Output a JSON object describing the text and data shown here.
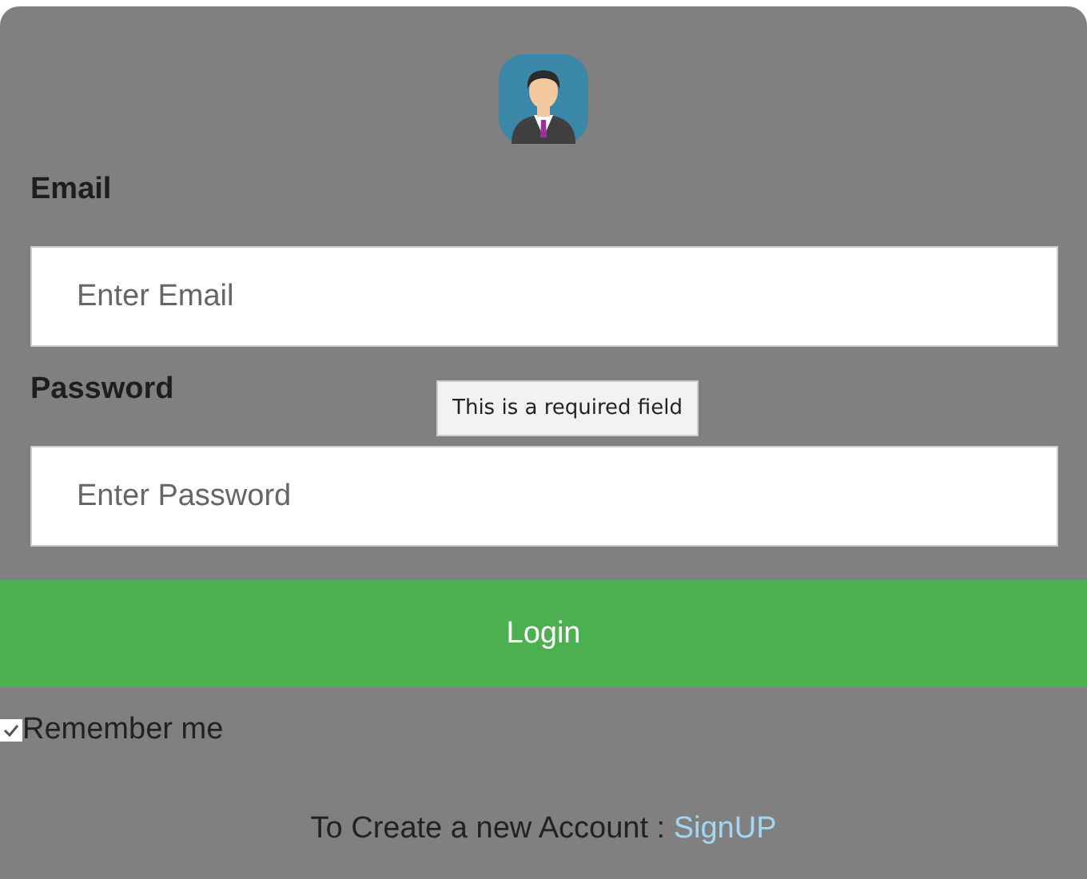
{
  "email": {
    "label": "Email",
    "placeholder": "Enter Email"
  },
  "password": {
    "label": "Password",
    "placeholder": "Enter Password"
  },
  "tooltip": "This is a required field",
  "login_button": "Login",
  "remember": {
    "label": "Remember me",
    "checked": true
  },
  "signup": {
    "text": "To Create a new Account :",
    "link": "SignUP"
  }
}
